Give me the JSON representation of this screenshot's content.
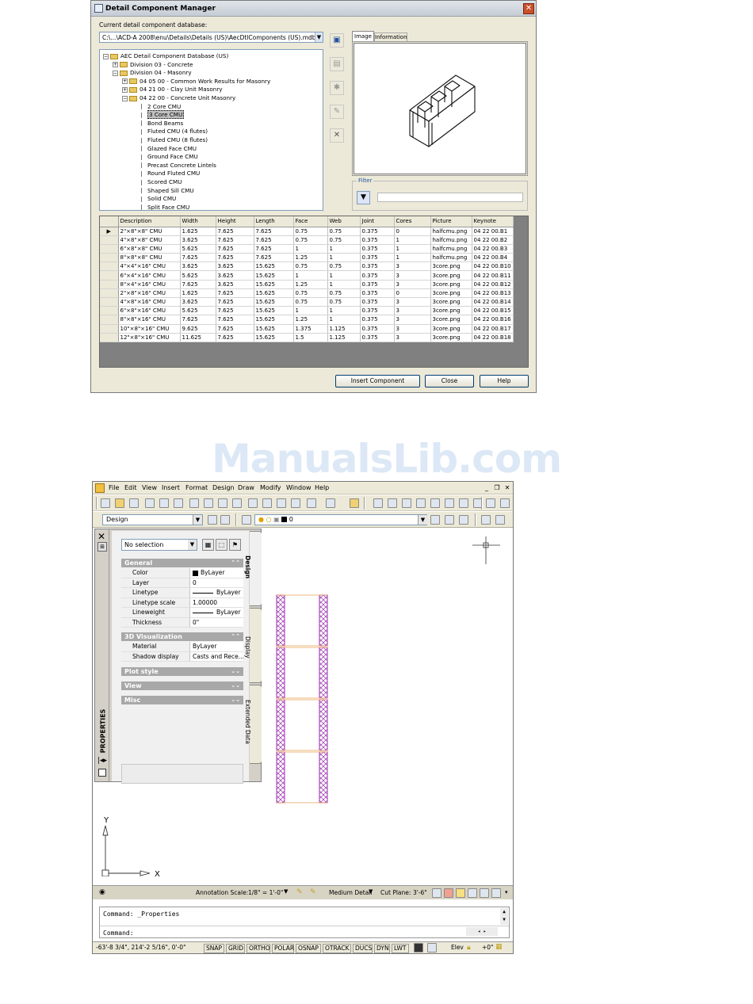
{
  "dialog": {
    "title": "Detail Component Manager",
    "close_glyph": "✕",
    "db_label": "Current detail component database:",
    "db_path": "C:\\...\\ACD-A 2008\\enu\\Details\\Details (US)\\AecDtlComponents (US).mdb",
    "tree": [
      {
        "level": 0,
        "type": "folder",
        "exp": "⊟",
        "label": "AEC Detail Component Database (US)"
      },
      {
        "level": 1,
        "type": "folder",
        "exp": "⊞",
        "label": "Division 03 - Concrete"
      },
      {
        "level": 1,
        "type": "folder",
        "exp": "⊟",
        "label": "Division 04 - Masonry"
      },
      {
        "level": 2,
        "type": "folder",
        "exp": "⊞",
        "label": "04 05 00 - Common Work Results for Masonry"
      },
      {
        "level": 2,
        "type": "folder",
        "exp": "⊞",
        "label": "04 21 00 - Clay Unit Masonry"
      },
      {
        "level": 2,
        "type": "folder",
        "exp": "⊟",
        "label": "04 22 00 - Concrete Unit Masonry"
      },
      {
        "level": 3,
        "type": "leaf",
        "label": "2 Core CMU"
      },
      {
        "level": 3,
        "type": "leaf",
        "label": "3 Core CMU",
        "selected": true
      },
      {
        "level": 3,
        "type": "leaf",
        "label": "Bond Beams"
      },
      {
        "level": 3,
        "type": "leaf",
        "label": "Fluted CMU (4 flutes)"
      },
      {
        "level": 3,
        "type": "leaf",
        "label": "Fluted CMU (8 flutes)"
      },
      {
        "level": 3,
        "type": "leaf",
        "label": "Glazed Face CMU"
      },
      {
        "level": 3,
        "type": "leaf",
        "label": "Ground Face CMU"
      },
      {
        "level": 3,
        "type": "leaf",
        "label": "Precast Concrete Lintels"
      },
      {
        "level": 3,
        "type": "leaf",
        "label": "Round Fluted CMU"
      },
      {
        "level": 3,
        "type": "leaf",
        "label": "Scored CMU"
      },
      {
        "level": 3,
        "type": "leaf",
        "label": "Shaped Sill CMU"
      },
      {
        "level": 3,
        "type": "leaf",
        "label": "Solid CMU"
      },
      {
        "level": 3,
        "type": "leaf",
        "label": "Split Face CMU"
      }
    ],
    "tabs": [
      "Image",
      "Information"
    ],
    "filter_label": "Filter",
    "table": {
      "columns": [
        "Description",
        "Width",
        "Height",
        "Length",
        "Face",
        "Web",
        "Joint",
        "Cores",
        "Picture",
        "Keynote"
      ],
      "current_row_marker": "▶",
      "rows": [
        [
          "2\"×8\"×8\" CMU",
          "1.625",
          "7.625",
          "7.625",
          "0.75",
          "0.75",
          "0.375",
          "0",
          "halfcmu.png",
          "04 22 00.B1"
        ],
        [
          "4\"×8\"×8\" CMU",
          "3.625",
          "7.625",
          "7.625",
          "0.75",
          "0.75",
          "0.375",
          "1",
          "halfcmu.png",
          "04 22 00.B2"
        ],
        [
          "6\"×8\"×8\" CMU",
          "5.625",
          "7.625",
          "7.625",
          "1",
          "1",
          "0.375",
          "1",
          "halfcmu.png",
          "04 22 00.B3"
        ],
        [
          "8\"×8\"×8\" CMU",
          "7.625",
          "7.625",
          "7.625",
          "1.25",
          "1",
          "0.375",
          "1",
          "halfcmu.png",
          "04 22 00.B4"
        ],
        [
          "4\"×4\"×16\" CMU",
          "3.625",
          "3.625",
          "15.625",
          "0.75",
          "0.75",
          "0.375",
          "3",
          "3core.png",
          "04 22 00.B10"
        ],
        [
          "6\"×4\"×16\" CMU",
          "5.625",
          "3.625",
          "15.625",
          "1",
          "1",
          "0.375",
          "3",
          "3core.png",
          "04 22 00.B11"
        ],
        [
          "8\"×4\"×16\" CMU",
          "7.625",
          "3.625",
          "15.625",
          "1.25",
          "1",
          "0.375",
          "3",
          "3core.png",
          "04 22 00.B12"
        ],
        [
          "2\"×8\"×16\" CMU",
          "1.625",
          "7.625",
          "15.625",
          "0.75",
          "0.75",
          "0.375",
          "0",
          "3core.png",
          "04 22 00.B13"
        ],
        [
          "4\"×8\"×16\" CMU",
          "3.625",
          "7.625",
          "15.625",
          "0.75",
          "0.75",
          "0.375",
          "3",
          "3core.png",
          "04 22 00.B14"
        ],
        [
          "6\"×8\"×16\" CMU",
          "5.625",
          "7.625",
          "15.625",
          "1",
          "1",
          "0.375",
          "3",
          "3core.png",
          "04 22 00.B15"
        ],
        [
          "8\"×8\"×16\" CMU",
          "7.625",
          "7.625",
          "15.625",
          "1.25",
          "1",
          "0.375",
          "3",
          "3core.png",
          "04 22 00.B16"
        ],
        [
          "10\"×8\"×16\" CMU",
          "9.625",
          "7.625",
          "15.625",
          "1.375",
          "1.125",
          "0.375",
          "3",
          "3core.png",
          "04 22 00.B17"
        ],
        [
          "12\"×8\"×16\" CMU",
          "11.625",
          "7.625",
          "15.625",
          "1.5",
          "1.125",
          "0.375",
          "3",
          "3core.png",
          "04 22 00.B18"
        ]
      ]
    },
    "buttons": {
      "insert": "Insert Component",
      "close": "Close",
      "help": "Help"
    }
  },
  "watermark": "ManualsLib.com",
  "aca": {
    "menu": [
      "File",
      "Edit",
      "View",
      "Insert",
      "Format",
      "Design",
      "Draw",
      "Modify",
      "Window",
      "Help"
    ],
    "window_controls": [
      "_",
      "❐",
      "✕"
    ],
    "style_combo": "Design",
    "layer_combo": "0",
    "properties": {
      "selection": "No selection",
      "close_glyph": "✕",
      "vertical_title": "PROPERTIES",
      "categories": {
        "general": "General",
        "viz": "3D Visualization",
        "plot": "Plot style",
        "view": "View",
        "misc": "Misc"
      },
      "general_rows": [
        {
          "key": "Color",
          "value": "ByLayer",
          "swatch": true
        },
        {
          "key": "Layer",
          "value": "0"
        },
        {
          "key": "Linetype",
          "value": "ByLayer",
          "line": true
        },
        {
          "key": "Linetype scale",
          "value": "1.00000"
        },
        {
          "key": "Lineweight",
          "value": "ByLayer",
          "line": true
        },
        {
          "key": "Thickness",
          "value": "0\""
        }
      ],
      "viz_rows": [
        {
          "key": "Material",
          "value": "ByLayer"
        },
        {
          "key": "Shadow display",
          "value": "Casts and Rece..."
        }
      ],
      "tabs": [
        "Design",
        "Display",
        "Extended Data"
      ]
    },
    "ucs": {
      "x": "X",
      "y": "Y"
    },
    "status": {
      "annotation_scale_label": "Annotation Scale:",
      "annotation_scale": "1/8\" = 1'-0\"",
      "detail": "Medium Detail",
      "cut_plane_label": "Cut Plane:",
      "cut_plane": "3'-6\""
    },
    "command_lines": [
      "Command: _Properties",
      "Command:"
    ],
    "coords": "-63'-8 3/4\", 214'-2 5/16\", 0'-0\"",
    "toggles": [
      "SNAP",
      "GRID",
      "ORTHO",
      "POLAR",
      "OSNAP",
      "OTRACK",
      "DUCS",
      "DYN",
      "LWT"
    ],
    "elev_label": "Elev",
    "elev_value": "+0\""
  },
  "colors": {
    "block_stroke": "#9b30b0",
    "block_cap": "#e8a050",
    "watermark": "#dce8f6"
  }
}
